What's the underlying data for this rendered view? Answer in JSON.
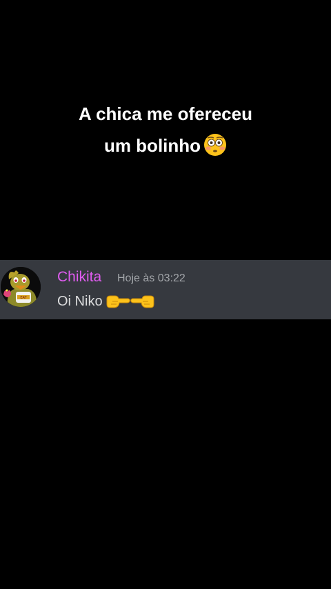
{
  "caption": {
    "line1": "A chica me ofereceu",
    "line2": "um bolinho",
    "emoji": "flushed-face-emoji"
  },
  "message": {
    "username": "Chikita",
    "timestamp": "Hoje às 03:22",
    "text": "Oi Niko",
    "username_color": "#e05cf0",
    "background": "#36393f",
    "emojis": [
      "pointing-right-emoji",
      "pointing-left-emoji"
    ]
  }
}
